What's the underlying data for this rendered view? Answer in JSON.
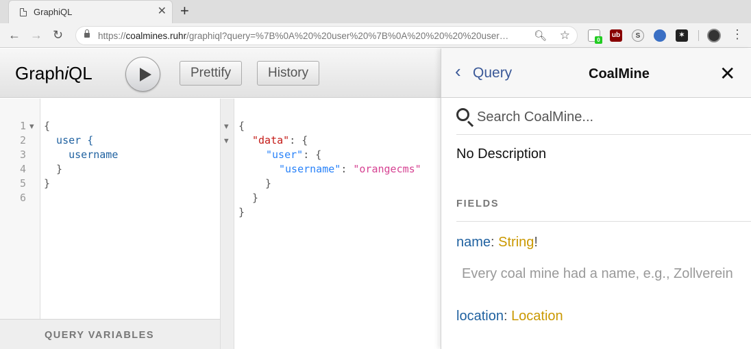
{
  "browser": {
    "tab_title": "GraphiQL",
    "tab_close": "✕",
    "new_tab": "+",
    "back": "←",
    "forward": "→",
    "reload": "↻",
    "url_prefix": "https://",
    "url_domain": "coalmines.ruhr",
    "url_rest": "/graphiql?query=%7B%0A%20%20user%20%7B%0A%20%20%20%20user…",
    "ext_badge": "0",
    "ext_ublock": "ub",
    "ext_s": "S",
    "menu": "⋮"
  },
  "graphiql": {
    "logo_pre": "Graph",
    "logo_i": "i",
    "logo_post": "QL",
    "prettify_label": "Prettify",
    "history_label": "History",
    "query_variables_label": "QUERY VARIABLES"
  },
  "editor": {
    "line_numbers": [
      "1",
      "2",
      "3",
      "4",
      "5",
      "6"
    ],
    "lines": [
      "{",
      "  user {",
      "    username",
      "  }",
      "}",
      ""
    ]
  },
  "result": {
    "open": "{",
    "data_key": "\"data\"",
    "user_key": "\"user\"",
    "username_key": "\"username\"",
    "username_value": "\"orangecms\"",
    "colon": ": ",
    "colon_brace": ": {",
    "close1": "}",
    "close2": "}",
    "close3": "}"
  },
  "docs": {
    "back_label": "Query",
    "title": "CoalMine",
    "close": "✕",
    "search_placeholder": "Search CoalMine...",
    "description": "No Description",
    "fields_header": "FIELDS",
    "fields": [
      {
        "name": "name",
        "type": "String",
        "suffix": "!",
        "description": "Every coal mine had a name, e.g., Zollverein"
      },
      {
        "name": "location",
        "type": "Location",
        "suffix": ""
      }
    ]
  }
}
